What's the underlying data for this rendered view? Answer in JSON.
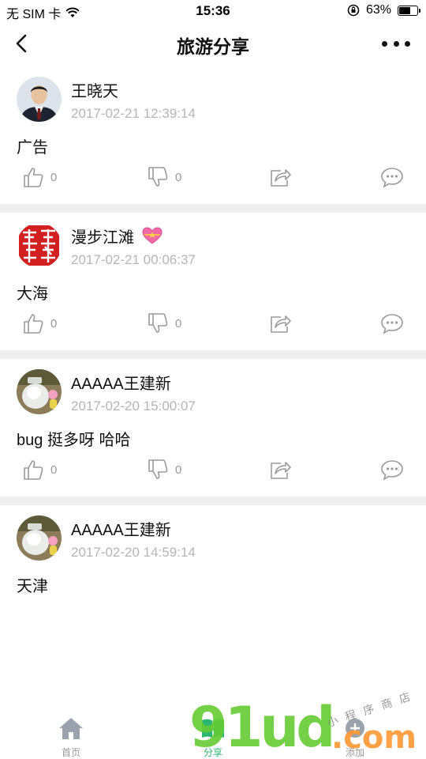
{
  "status_bar": {
    "carrier": "无 SIM 卡",
    "time": "15:36",
    "battery_percent": "63%",
    "battery_level": 0.63,
    "icons": [
      "wifi-icon",
      "rotation-lock-icon",
      "battery-icon"
    ]
  },
  "nav": {
    "title": "旅游分享",
    "back_icon": "chevron-left-icon",
    "more_icon": "more-dots-icon"
  },
  "posts": [
    {
      "username": "王晓天",
      "time": "2017-02-21 12:39:14",
      "content": "广告",
      "likes": "0",
      "dislikes": "0",
      "avatar": "man-in-suit"
    },
    {
      "username": "漫步江滩",
      "time": "2017-02-21 00:06:37",
      "content": "大海",
      "likes": "0",
      "dislikes": "0",
      "avatar": "red-seal",
      "badge": "heart-emoji"
    },
    {
      "username": "AAAAA王建新",
      "time": "2017-02-20 15:00:07",
      "content": "bug 挺多呀 哈哈",
      "likes": "0",
      "dislikes": "0",
      "avatar": "glass-jar"
    },
    {
      "username": "AAAAA王建新",
      "time": "2017-02-20 14:59:14",
      "content": "天津",
      "avatar": "glass-jar"
    }
  ],
  "tab_bar": {
    "items": [
      {
        "label": "首页",
        "icon": "home-icon"
      },
      {
        "label": "分享",
        "icon": "share-book-icon"
      },
      {
        "label": "添加",
        "icon": "add-icon"
      }
    ],
    "active_color": "#2bb673"
  },
  "watermark": {
    "main": "91ud",
    "domain": ".com",
    "tagline": "小程序商店"
  },
  "colors": {
    "separator": "#efefef",
    "timestamp": "#b5b5b5",
    "icon": "#9a9a9a"
  }
}
